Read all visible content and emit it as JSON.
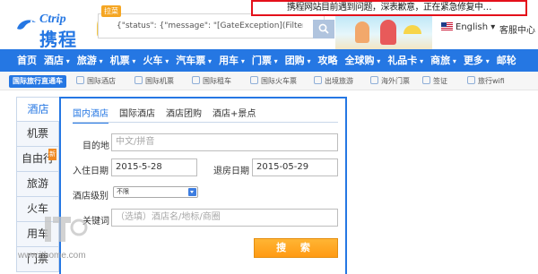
{
  "notice": "携程网站目前遇到问题，深表歉意，正在紧急修复中…",
  "logo": {
    "en": "Ctrip",
    "cn": "携程"
  },
  "search": {
    "badge": "拉菜",
    "value": "{\"status\": {\"message\": \"[GateException](Filter threw Except"
  },
  "header": {
    "language": "English",
    "help": "客服中心"
  },
  "nav": [
    {
      "label": "首页",
      "drop": false
    },
    {
      "label": "酒店",
      "drop": true
    },
    {
      "label": "旅游",
      "drop": true
    },
    {
      "label": "机票",
      "drop": true
    },
    {
      "label": "火车",
      "drop": true
    },
    {
      "label": "汽车票",
      "drop": true
    },
    {
      "label": "用车",
      "drop": true
    },
    {
      "label": "门票",
      "drop": true
    },
    {
      "label": "团购",
      "drop": true
    },
    {
      "label": "攻略",
      "drop": false
    },
    {
      "label": "全球购",
      "drop": true
    },
    {
      "label": "礼品卡",
      "drop": true
    },
    {
      "label": "商旅",
      "drop": true
    },
    {
      "label": "更多",
      "drop": true
    },
    {
      "label": "邮轮",
      "drop": false
    }
  ],
  "subnav": {
    "tag": "国际旅行直通车",
    "items": [
      "国际酒店",
      "国际机票",
      "国际租车",
      "国际火车票",
      "出境旅游",
      "海外门票",
      "签证",
      "旅行wifi"
    ]
  },
  "side_tabs": [
    "酒店",
    "机票",
    "自由行",
    "旅游",
    "火车",
    "用车",
    "门票"
  ],
  "side_new_tag": "新",
  "form": {
    "tabs": [
      "国内酒店",
      "国际酒店",
      "酒店团购",
      "酒店+景点"
    ],
    "destination_label": "目的地",
    "destination_placeholder": "中文/拼音",
    "checkin_label": "入住日期",
    "checkin_value": "2015-5-28",
    "checkout_label": "退房日期",
    "checkout_value": "2015-05-29",
    "level_label": "酒店级别",
    "level_value": "不限",
    "keyword_label": "关键词",
    "keyword_placeholder": "（选填）酒店名/地标/商圈",
    "submit": "搜 索"
  },
  "watermark": {
    "logo": "IT之家",
    "url": "www.ithome.com"
  },
  "colors": {
    "brand_blue": "#2577e3",
    "search_orange": "#ff9a13",
    "notice_red": "#e4101a"
  }
}
